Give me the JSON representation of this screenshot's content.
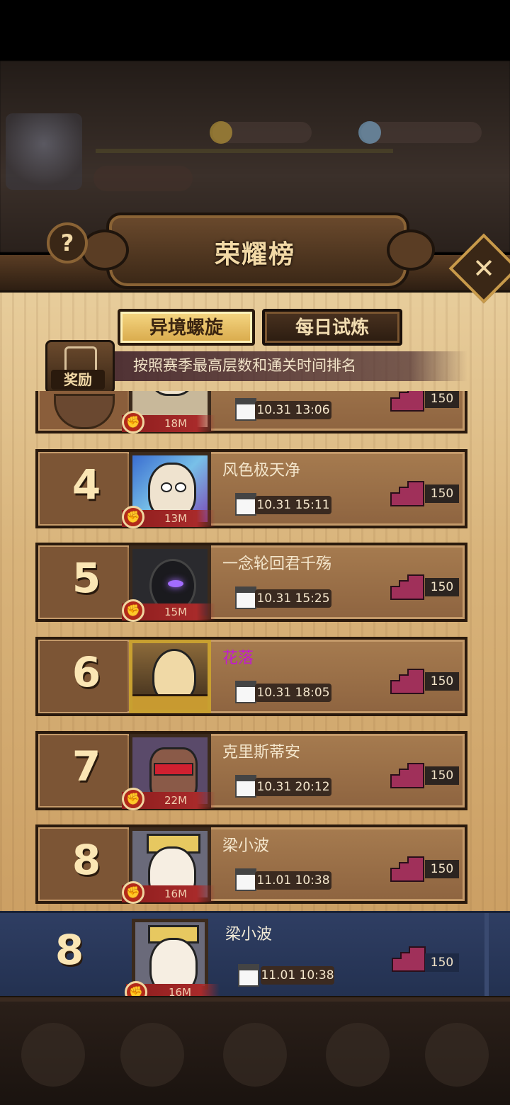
{
  "dialog": {
    "title": "荣耀榜",
    "help_label": "?",
    "close_label": "✕"
  },
  "tabs": [
    {
      "label": "异境螺旋",
      "active": true
    },
    {
      "label": "每日试炼",
      "active": false
    }
  ],
  "reward": {
    "label": "奖励"
  },
  "description": "按照赛季最高层数和通关时间排名",
  "rows": [
    {
      "rank": "",
      "name": "",
      "power": "18M",
      "time": "10.31 13:06",
      "floor": "150"
    },
    {
      "rank": "4",
      "name": "风色极天净",
      "power": "13M",
      "time": "10.31 15:11",
      "floor": "150"
    },
    {
      "rank": "5",
      "name": "一念轮回君千殇",
      "power": "15M",
      "time": "10.31 15:25",
      "floor": "150"
    },
    {
      "rank": "6",
      "name": "花落",
      "power": "",
      "time": "10.31 18:05",
      "floor": "150"
    },
    {
      "rank": "7",
      "name": "克里斯蒂安",
      "power": "22M",
      "time": "10.31 20:12",
      "floor": "150"
    },
    {
      "rank": "8",
      "name": "梁小波",
      "power": "16M",
      "time": "11.01 10:38",
      "floor": "150"
    }
  ],
  "my_rank": {
    "rank": "8",
    "name": "梁小波",
    "power": "16M",
    "time": "11.01 10:38",
    "floor": "150"
  },
  "colors": {
    "name_highlight": "#c21ad0",
    "floor_icon": "#a0305a",
    "my_row": "#2f3e63"
  },
  "icons": {
    "power": "fist-icon",
    "time": "calendar-icon",
    "floor": "stairs-icon"
  }
}
